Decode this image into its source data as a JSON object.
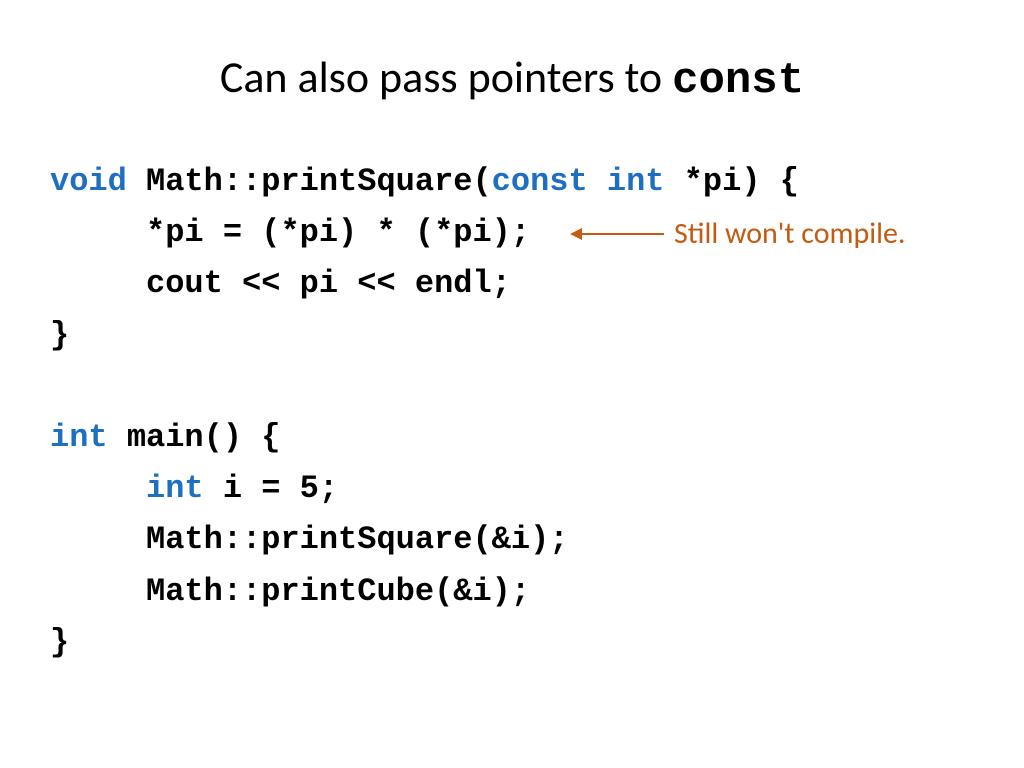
{
  "title": {
    "pre": "Can also pass pointers to ",
    "mono": "const"
  },
  "annotation": "Still won't compile.",
  "code": {
    "l1": {
      "kw1": "void",
      "a": " Math::printSquare(",
      "kw2": "const",
      "b": " ",
      "kw3": "int",
      "c": " *pi) {"
    },
    "l2": "     *pi = (*pi) * (*pi);",
    "l3": "     cout << pi << endl;",
    "l4": "}",
    "l5": "",
    "l6": {
      "kw1": "int",
      "a": " main() {"
    },
    "l7": {
      "a": "     ",
      "kw1": "int",
      "b": " i = 5;"
    },
    "l8": "     Math::printSquare(&i);",
    "l9": "     Math::printCube(&i);",
    "l10": "}"
  }
}
